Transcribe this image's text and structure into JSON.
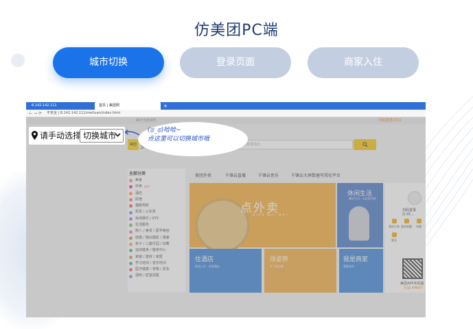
{
  "page_title": "仿美团PC端",
  "tabs": [
    {
      "label": "城市切换"
    },
    {
      "label": "登录页面"
    },
    {
      "label": "商家入住"
    }
  ],
  "colors": {
    "accent": "#1a73e8",
    "inactive_tab": "#c3cfe0",
    "title": "#1d3b73"
  },
  "browser": {
    "tab1_title": "8.142.142.111",
    "tab2_title": "首页 | 美团网",
    "new_tab": "+",
    "address": "不安全 | 8.142.142.111/meituan/index.html",
    "nav": "← → ⟳"
  },
  "site": {
    "topbar_left": "美手当前城市",
    "topbar_right": "扫码登录2021",
    "logo_badge": "美团",
    "logo_text": "美团",
    "search_placeholder": "搜索美食商家或地点",
    "search_button_icon": "search-icon",
    "category_header": "全部分类",
    "categories": [
      {
        "label": "美食",
        "hot": ""
      },
      {
        "label": "外卖",
        "hot": "HOT"
      },
      {
        "label": "酒店",
        "hot": ""
      },
      {
        "label": "民宿",
        "hot": ""
      },
      {
        "label": "猫眼电影",
        "hot": ""
      },
      {
        "label": "机票 / 火车票",
        "hot": ""
      },
      {
        "label": "休闲娱乐 / KTV",
        "hot": ""
      },
      {
        "label": "生活服务",
        "hot": ""
      },
      {
        "label": "丽人 / 美发 / 医学美容",
        "hot": ""
      },
      {
        "label": "结婚 / 婚纱摄影 / 婚宴",
        "hot": ""
      },
      {
        "label": "亲子 / 儿童乐园 / 幼教",
        "hot": ""
      },
      {
        "label": "运动健身 / 健身中心",
        "hot": ""
      },
      {
        "label": "家装 / 建材 / 家居",
        "hot": ""
      },
      {
        "label": "学习培训 / 音乐培训",
        "hot": ""
      },
      {
        "label": "医疗健康 / 宠物 / 爱车",
        "hot": ""
      },
      {
        "label": "酒吧 / 密室逃脱",
        "hot": ""
      }
    ],
    "nav_links": [
      "美团外卖",
      "千锋云直播",
      "千锋云音乐",
      "千锋云大屏数据可视化平台"
    ],
    "banner_main": "点外卖",
    "banner_sub": "DIAN WAI MAI",
    "banner_side_title": "休闲生活",
    "banner_side_sub": "美好生活 · 从这里开始",
    "tiles": [
      {
        "title": "住酒店",
        "sub": "舒适入住 · 优质酒店"
      },
      {
        "title": "涨姿势",
        "sub": "学习新技能"
      },
      {
        "title": "我是商家",
        "sub": "我要合作"
      }
    ],
    "user_name": "扫码登录Q:35...",
    "user_actions": [
      "我的订单",
      "我的收藏",
      "余额",
      "更多"
    ],
    "app_label": "美团APP手机版",
    "app_sub": "1元起 吃喝玩乐"
  },
  "city_selector": {
    "prompt": "请手动选择",
    "switch_label": "切换城市"
  },
  "annotation": {
    "line1": "(ಥ_ಥ)哈哈~",
    "line2": "点这里可以切换城市哦"
  }
}
